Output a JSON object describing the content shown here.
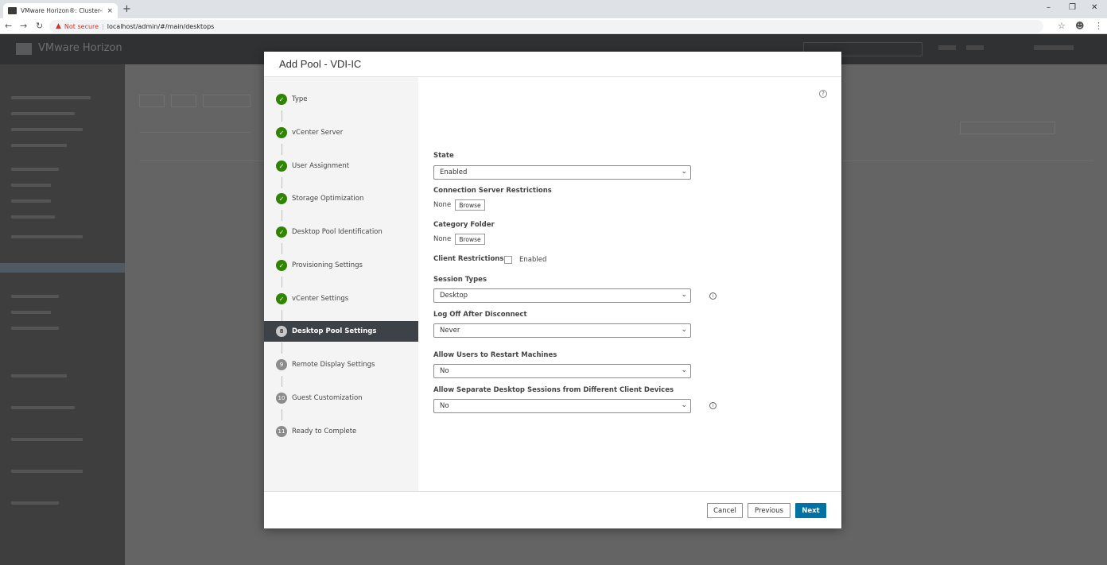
{
  "browser": {
    "tab_title": "VMware Horizon®: Cluster-FS-K",
    "tab_close": "×",
    "new_tab": "+",
    "security_label": "Not secure",
    "url": "localhost/admin/#/main/desktops"
  },
  "app": {
    "product_name": "VMware Horizon"
  },
  "modal": {
    "title": "Add Pool - VDI-IC",
    "steps": [
      {
        "label": "Type",
        "marker": "✓"
      },
      {
        "label": "vCenter Server",
        "marker": "✓"
      },
      {
        "label": "User Assignment",
        "marker": "✓"
      },
      {
        "label": "Storage Optimization",
        "marker": "✓"
      },
      {
        "label": "Desktop Pool Identification",
        "marker": "✓"
      },
      {
        "label": "Provisioning Settings",
        "marker": "✓"
      },
      {
        "label": "vCenter Settings",
        "marker": "✓"
      },
      {
        "label": "Desktop Pool Settings",
        "marker": "8"
      },
      {
        "label": "Remote Display Settings",
        "marker": "9"
      },
      {
        "label": "Guest Customization",
        "marker": "10"
      },
      {
        "label": "Ready to Complete",
        "marker": "11"
      }
    ],
    "form": {
      "state_label": "State",
      "state_value": "Enabled",
      "conn_label": "Connection Server Restrictions",
      "conn_value": "None",
      "browse": "Browse",
      "category_label": "Category Folder",
      "category_value": "None",
      "client_label": "Client Restrictions",
      "client_checkbox": "Enabled",
      "session_label": "Session Types",
      "session_value": "Desktop",
      "logoff_label": "Log Off After Disconnect",
      "logoff_value": "Never",
      "restart_label": "Allow Users to Restart Machines",
      "restart_value": "No",
      "separate_label": "Allow Separate Desktop Sessions from Different Client Devices",
      "separate_value": "No"
    },
    "footer": {
      "cancel": "Cancel",
      "previous": "Previous",
      "next": "Next"
    }
  },
  "colors": {
    "accent": "#0072a3",
    "done": "#2f8400",
    "active_step": "#3d4148"
  }
}
